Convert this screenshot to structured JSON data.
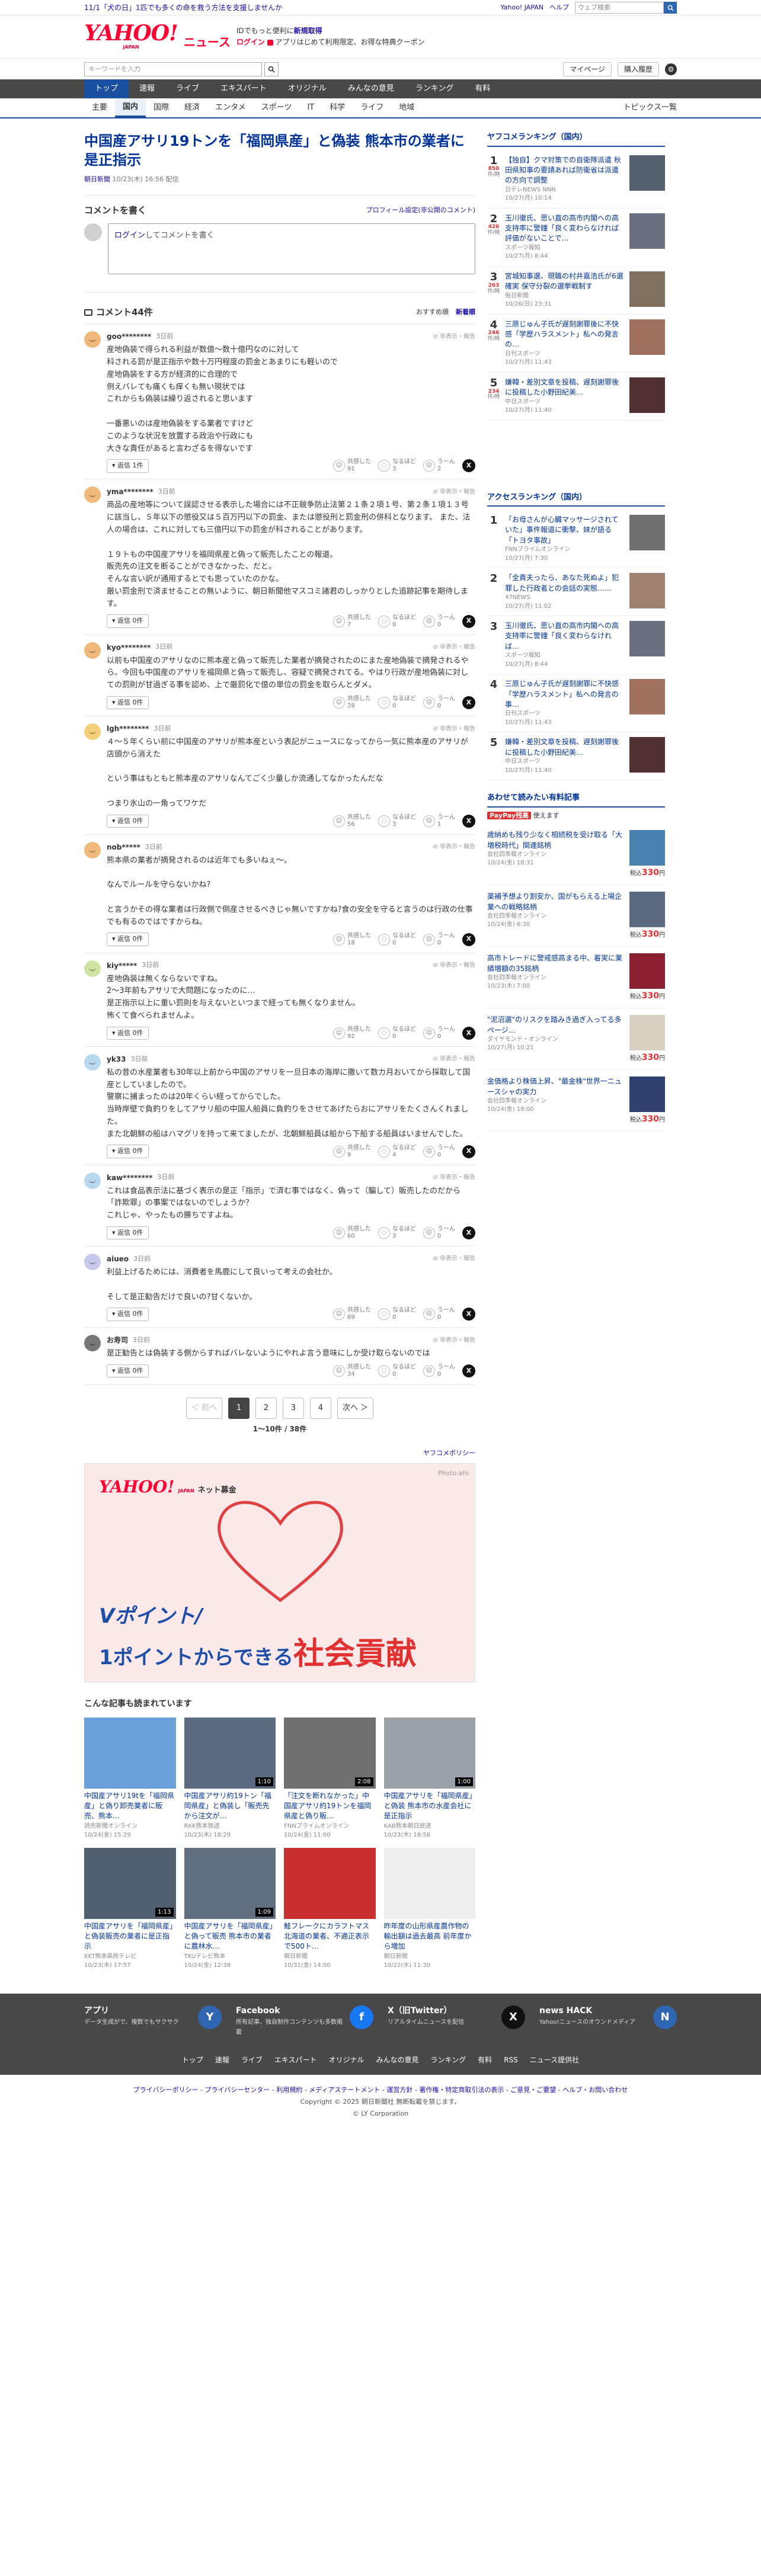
{
  "promo": {
    "text": "11/1「犬の日」1匹でも多くの命を救う方法を支援しませんか",
    "links": [
      "Yahoo! JAPAN",
      "ヘルプ"
    ],
    "search_placeholder": "ウェブ検索"
  },
  "header": {
    "logo_main": "YAHOO!",
    "logo_sub": "JAPAN",
    "logo_news": "ニュース",
    "line1_a": "IDでもっと便利に",
    "line1_b": "新規取得",
    "line2_a": "ログイン",
    "line2_b": "アプリはじめて利用限定、お得な特典クーポン"
  },
  "search": {
    "placeholder": "キーワードを入力",
    "mypage": "マイページ",
    "purchase": "購入履歴"
  },
  "nav": [
    "トップ",
    "速報",
    "ライブ",
    "エキスパート",
    "オリジナル",
    "みんなの意見",
    "ランキング",
    "有料"
  ],
  "subnav": [
    "主要",
    "国内",
    "国際",
    "経済",
    "エンタメ",
    "スポーツ",
    "IT",
    "科学",
    "ライフ",
    "地域"
  ],
  "subnav_right": "トピックス一覧",
  "article": {
    "title": "中国産アサリ19トンを「福岡県産」と偽装 熊本市の業者に是正指示",
    "source": "朝日新聞",
    "date": "10/23(木) 16:56 配信"
  },
  "post": {
    "heading": "コメントを書く",
    "profile_link": "プロフィール設定(非公開のコメント)",
    "login": "ログイン",
    "placeholder_rest": "してコメントを書く"
  },
  "comments_header": {
    "title": "コメント44件",
    "sort_recommended": "おすすめ順",
    "sort_new": "新着順"
  },
  "comment_ui": {
    "report": "非表示・報告",
    "agree": "共感した",
    "hmm": "なるほど",
    "disagree": "うーん"
  },
  "comments": [
    {
      "user": "goo********",
      "time": "3日前",
      "text": "産地偽装で得られる利益が数億〜数十億円なのに対して\n科される罰が是正指示や数十万円程度の罰金とあまりにも軽いので\n産地偽装をする方が経済的に合理的で\n例えバレても痛くも痒くも無い現状では\nこれからも偽装は繰り返されると思います\n\n一番悪いのは産地偽装をする業者ですけど\nこのような状況を放置する政治や行政にも\n大きな責任があると言わざるを得ないです",
      "reply": "返信 1件",
      "agree": "91",
      "hmm": "3",
      "disagree": "2",
      "color": "#f0b87a"
    },
    {
      "user": "yma********",
      "time": "3日前",
      "text": "商品の産地等について誤認させる表示した場合には不正競争防止法第２１条２項１号、第２条１項１３号に該当し、５年以下の懲役又は５百万円以下の罰金、または懲役刑と罰金刑の併科となります。 また、法人の場合は、これに対しても三億円以下の罰金が科されることがあります。\n\n１９トもの中国産アサリを福岡県産と偽って販売したことの報道。\n販売先の注文を断ることができなかった、だと。\nそんな言い訳が通用するとでも思っていたのかな。\n厳い罰金刑で済ませることの無いように、朝日新聞他マスコミ諸君のしっかりとした追跡記事を期待します。",
      "reply": "返信 0件",
      "agree": "7",
      "hmm": "0",
      "disagree": "0",
      "color": "#f0b87a"
    },
    {
      "user": "kyo********",
      "time": "3日前",
      "text": "以前も中国産のアサリなのに熊本産と偽って販売した業者が摘発されたのにまた産地偽装で摘発されるやら。今回も中国産のアサリを福岡県と偽って販売し、容疑で摘発されてる。やはり行政が産地偽装に対しての罰則が甘過ぎる事を認め、上で厳罰化で億の単位の罰金を取らんとダメ。",
      "reply": "返信 0件",
      "agree": "28",
      "hmm": "0",
      "disagree": "0",
      "color": "#f0b87a"
    },
    {
      "user": "lgh********",
      "time": "3日前",
      "text": "４〜５年くらい前に中国産のアサリが熊本産という表記がニュースになってから一気に熊本産のアサリが店頭から消えた\n\nという事はもともと熊本産のアサリなんてごく少量しか流通してなかったんだな\n\nつまり氷山の一角ってワケだ",
      "reply": "返信 0件",
      "agree": "56",
      "hmm": "3",
      "disagree": "1",
      "color": "#f5d07a"
    },
    {
      "user": "nob*****",
      "time": "3日前",
      "text": "熊本県の業者が摘発されるのは近年でも多いねぇ〜。\n\nなんでルールを守らないかね?\n\nと言うかその得な業者は行政側で倒産させるべきじゃ無いですかね?食の安全を守ると言うのは行政の仕事でも有るのではですからね。",
      "reply": "返信 0件",
      "agree": "18",
      "hmm": "0",
      "disagree": "0",
      "color": "#f0b87a"
    },
    {
      "user": "kiy*****",
      "time": "3日前",
      "text": "産地偽装は無くならないですね。\n2〜3年前もアサリで大問題になったのに…\n是正指示以上に重い罰則を与えないといつまで経っても無くなりません。\n怖くて食べられませんよ。",
      "reply": "返信 0件",
      "agree": "92",
      "hmm": "0",
      "disagree": "0",
      "color": "#cfe4a0"
    },
    {
      "user": "yk33",
      "time": "3日前",
      "text": "私の昔の水産業者も30年以上前から中国のアサリを一旦日本の海岸に撒いて数カ月おいてから採取して国産としていましたので。\n警察に捕まったのは20年くらい経ってからでした。\n当時岸壁で負釣りをしてアサリ船の中国人船員に負釣りをさせてあげたらおにアサリをたくさんくれました。\nまた北朝鮮の船はハマグリを持って来てましたが、北朝鮮船員は船から下船する船員はいませんでした。",
      "reply": "返信 0件",
      "agree": "9",
      "hmm": "4",
      "disagree": "0",
      "color": "#b8d8f0"
    },
    {
      "user": "kaw********",
      "time": "3日前",
      "text": "これは食品表示法に基づく表示の是正「指示」で済む事ではなく、偽って（騙して）販売したのだから「詐欺罪」の事案ではないのでしょうか？\nこれじゃ、やったもの勝ちですよね。",
      "reply": "返信 0件",
      "agree": "60",
      "hmm": "3",
      "disagree": "0",
      "color": "#b8d8f0"
    },
    {
      "user": "aiueo",
      "time": "3日前",
      "text": "利益上げるためには、消費者を馬鹿にして良いって考えの会社か。\n\nそして是正勧告だけで良いの?甘くないか。",
      "reply": "返信 0件",
      "agree": "69",
      "hmm": "0",
      "disagree": "0",
      "color": "#c8c8ec"
    },
    {
      "user": "お寿司",
      "time": "3日前",
      "text": "是正勧告とは偽装する側からすればバレないようにやれよ言う意味にしか受け取らないのでは",
      "reply": "返信 0件",
      "agree": "34",
      "hmm": "0",
      "disagree": "0",
      "color": "#777777"
    }
  ],
  "pagination": {
    "prev": "＜ 前へ",
    "pages": [
      "1",
      "2",
      "3",
      "4"
    ],
    "next": "次へ ＞",
    "count": "1〜10件 / 38件"
  },
  "ad": {
    "policy": "ヤフコメポリシー",
    "logo": "YAHOO!",
    "logo_sub": "JAPAN",
    "logo_text": "ネット募金",
    "credit": "Photo:afo",
    "copy1": "Vポイント/",
    "copy2a": "1ポイントからできる",
    "copy2b": "社会貢献"
  },
  "related": {
    "title": "こんな記事も読まれています",
    "items": [
      {
        "title": "中国産アサリ19tを「福岡県産」と偽り卸売業者に販売、熊本…",
        "source": "読売新聞オンライン",
        "date": "10/24(金) 15:29",
        "color": "#6aa0d8",
        "dur": ""
      },
      {
        "title": "中国産アサリ約19トン「福岡県産」と偽装し「販売先から注文が…",
        "source": "RKK熊本放送",
        "date": "10/23(木) 18:29",
        "color": "#5a6a80",
        "dur": "1:10"
      },
      {
        "title": "「注文を断れなかった」中国産アサリ約19トンを福岡県産と偽り販…",
        "source": "FNNプライムオンライン",
        "date": "10/24(金) 11:00",
        "color": "#707070",
        "dur": "2:08"
      },
      {
        "title": "中国産アサリを「福岡県産」と偽装 熊本市の水産会社に是正指示",
        "source": "KAB熊本朝日放送",
        "date": "10/23(木) 18:58",
        "color": "#9aa0a8",
        "dur": "1:00"
      },
      {
        "title": "中国産アサリを「福岡県産」と偽装販売の業者に是正指示",
        "source": "KKT熊本県民テレビ",
        "date": "10/23(木) 17:57",
        "color": "#506070",
        "dur": "1:13"
      },
      {
        "title": "中国産アサリを「福岡県産」と偽って販売 熊本市の業者に農林水…",
        "source": "TKUテレビ熊本",
        "date": "10/24(金) 12:38",
        "color": "#607080",
        "dur": "1:09"
      },
      {
        "title": "鮭フレークにカラフトマス 北海道の業者、不適正表示で500ト…",
        "source": "朝日新聞",
        "date": "10/31(金) 14:00",
        "color": "#c83030",
        "dur": ""
      },
      {
        "title": "昨年度の山形県産農作物の輸出額は過去最高 前年度から増加",
        "source": "朝日新聞",
        "date": "10/22(水) 11:30",
        "color": "#eeeeee",
        "dur": ""
      }
    ]
  },
  "sidebar": {
    "ranking_title": "ヤフコメランキング（国内）",
    "ranking": [
      {
        "n": "1",
        "count": "850",
        "unit": "件/時",
        "title": "【独自】クマ対策での自衛隊派遣 秋田県知事の要請あれば防衛省は派遣の方向で調整",
        "source": "日テレNEWS NNN",
        "date": "10/27(月) 10:14",
        "color": "#556070"
      },
      {
        "n": "2",
        "count": "426",
        "unit": "件/時",
        "title": "玉川徹氏、思い直の高市内閣への高支持率に警鐘「良く変わらなければ評価がないことで…",
        "source": "スポーツ報知",
        "date": "10/27(月) 8:44",
        "color": "#6a7080"
      },
      {
        "n": "3",
        "count": "263",
        "unit": "件/時",
        "title": "宮城知事選、現職の村井嘉浩氏が6選確実 保守分裂の選挙戦制す",
        "source": "毎日新聞",
        "date": "10/26(日) 23:31",
        "color": "#807060"
      },
      {
        "n": "4",
        "count": "246",
        "unit": "件/時",
        "title": "三原じゅん子氏が遅刻謝罪後に不快感「学歴ハラスメント」私への発言の…",
        "source": "日刊スポーツ",
        "date": "10/27(月) 11:43",
        "color": "#a07060"
      },
      {
        "n": "5",
        "count": "234",
        "unit": "件/時",
        "title": "嫌韓・差別文章を投稿、遅刻謝罪後に投稿した小野田紀美…",
        "source": "中日スポーツ",
        "date": "10/27(月) 11:40",
        "color": "#503030"
      }
    ],
    "access_title": "アクセスランキング（国内）",
    "access": [
      {
        "n": "1",
        "title": "「お母さんが心臓マッサージされていた」事件報道に衝撃、妹が語る「トヨタ事故」",
        "source": "FNNプライムオンライン",
        "date": "10/27(月) 7:30",
        "color": "#707070"
      },
      {
        "n": "2",
        "title": "「全責夫ったら、あなた死ぬよ」犯罪した行政者との会話の実態……",
        "source": "47NEWS",
        "date": "10/27(月) 11:02",
        "color": "#a08070"
      },
      {
        "n": "3",
        "title": "玉川徹氏、思い直の高市内閣への高支持率に警鐘「良く変わらなければ…",
        "source": "スポーツ報知",
        "date": "10/27(月) 8:44",
        "color": "#6a7080"
      },
      {
        "n": "4",
        "title": "三原じゅん子氏が遅刻謝罪に不快感「学歴ハラスメント」私への発言の事…",
        "source": "日刊スポーツ",
        "date": "10/27(月) 11:43",
        "color": "#a07060"
      },
      {
        "n": "5",
        "title": "嫌韓・差別文章を投稿、遅刻謝罪後に投稿した小野田紀美…",
        "source": "中日スポーツ",
        "date": "10/27(月) 11:40",
        "color": "#503030"
      }
    ],
    "paid_title": "あわせて読みたい有料記事",
    "paypay_badge": "PayPay残高",
    "paypay_text": "使えます",
    "paid": [
      {
        "title": "歳納めも残り少なく相続税を受け取る「大増税時代」関連銘柄",
        "source": "会社四季報オンライン",
        "date": "10/24(金) 18:31",
        "price": "330",
        "color": "#4a80b0"
      },
      {
        "title": "薬補予想より割安か、国がもらえる上場企業への戦略銘柄",
        "source": "会社四季報オンライン",
        "date": "10/24(金) 6:30",
        "price": "330",
        "color": "#5a6a80"
      },
      {
        "title": "高市トレードに警戒感高まる中、着実に業績増額の35銘柄",
        "source": "会社四季報オンライン",
        "date": "10/23(木) 7:00",
        "price": "330",
        "color": "#8a2030"
      },
      {
        "title": "\"泥沼選\"のリスクを踏みき過ぎ入ってる多ページ…",
        "source": "ダイヤモンド・オンライン",
        "date": "10/27(月) 10:21",
        "price": "330",
        "color": "#d8d0c0"
      },
      {
        "title": "金価格より株価上昇、\"最金株\"世界一ニュースシャの実力",
        "source": "会社四季報オンライン",
        "date": "10/24(金) 18:00",
        "price": "330",
        "color": "#304070"
      }
    ],
    "price_label": "税込",
    "price_unit": "円"
  },
  "footer": {
    "apps": [
      {
        "name": "アプリ",
        "desc": "データ生成がで、複数でもサクサク",
        "color": "#2f66b2",
        "glyph": "Y"
      },
      {
        "name": "Facebook",
        "desc": "所有記事、独自制作コンテンツも多数掲載",
        "color": "#1877f2",
        "glyph": "f"
      },
      {
        "name": "X（旧Twitter）",
        "desc": "リアルタイムニュースを配信",
        "color": "#111111",
        "glyph": "X"
      },
      {
        "name": "news HACK",
        "desc": "Yahoo!ニュースのオウンドメディア",
        "color": "#2f66b2",
        "glyph": "N"
      }
    ],
    "nav": [
      "トップ",
      "速報",
      "ライブ",
      "エキスパート",
      "オリジナル",
      "みんなの意見",
      "ランキング",
      "有料",
      "RSS",
      "ニュース提供社"
    ],
    "links": "プライバシーポリシー - プライバシーセンター - 利用規約 - メディアステートメント - 運営方針 - 著作権・特定商取引法の表示 - ご意見・ご要望 - ヘルプ・お問い合わせ",
    "copyright1": "Copyright © 2025 朝日新聞社 無断転載を禁じます。",
    "copyright2": "© LY Corporation"
  }
}
